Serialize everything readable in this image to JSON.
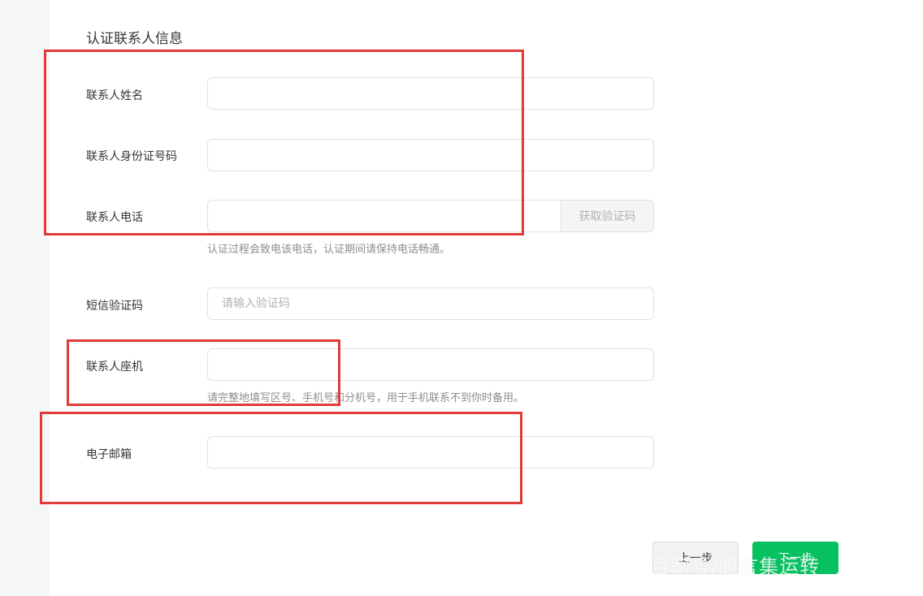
{
  "section": {
    "title": "认证联系人信息"
  },
  "fields": {
    "contact_name": {
      "label": "联系人姓名",
      "value": ""
    },
    "contact_id": {
      "label": "联系人身份证号码",
      "value": ""
    },
    "contact_phone": {
      "label": "联系人电话",
      "value": "",
      "button": "获取验证码",
      "hint": "认证过程会致电该电话，认证期间请保持电话畅通。"
    },
    "sms_code": {
      "label": "短信验证码",
      "placeholder": "请输入验证码",
      "value": ""
    },
    "landline": {
      "label": "联系人座机",
      "value": "",
      "hint": "请完整地填写区号、手机号和分机号，用于手机联系不到你时备用。"
    },
    "email": {
      "label": "电子邮箱",
      "value": ""
    }
  },
  "actions": {
    "prev": "上一步",
    "next": "下一步"
  },
  "watermark": "百家号/胆言集运转",
  "colors": {
    "accent": "#07c160",
    "annotation": "#e03a3a"
  }
}
